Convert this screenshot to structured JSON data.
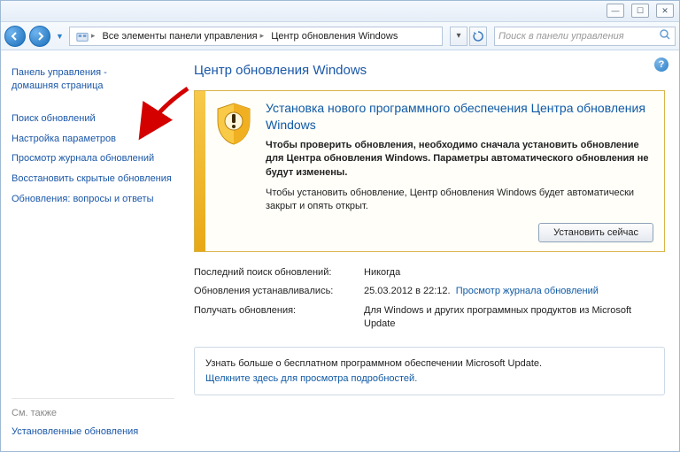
{
  "breadcrumb": {
    "seg1": "Все элементы панели управления",
    "seg2": "Центр обновления Windows"
  },
  "search": {
    "placeholder": "Поиск в панели управления"
  },
  "sidebar": {
    "home1": "Панель управления -",
    "home2": "домашняя страница",
    "items": [
      "Поиск обновлений",
      "Настройка параметров",
      "Просмотр журнала обновлений",
      "Восстановить скрытые обновления",
      "Обновления: вопросы и ответы"
    ],
    "see_also": "См. также",
    "installed": "Установленные обновления"
  },
  "main": {
    "title": "Центр обновления Windows",
    "alert": {
      "title": "Установка нового программного обеспечения Центра обновления Windows",
      "bold": "Чтобы проверить обновления, необходимо сначала установить обновление для Центра обновления Windows. Параметры автоматического обновления не будут изменены.",
      "plain": "Чтобы установить обновление, Центр обновления Windows будет автоматически закрыт и опять открыт.",
      "button": "Установить сейчас"
    },
    "info": {
      "row1_label": "Последний поиск обновлений:",
      "row1_value": "Никогда",
      "row2_label": "Обновления устанавливались:",
      "row2_value": "25.03.2012 в 22:12.",
      "row2_link": "Просмотр журнала обновлений",
      "row3_label": "Получать обновления:",
      "row3_value": "Для Windows и других программных продуктов из Microsoft Update"
    },
    "msupdate": {
      "line1": "Узнать больше о бесплатном программном обеспечении Microsoft Update.",
      "line2": "Щелкните здесь для просмотра подробностей."
    }
  }
}
